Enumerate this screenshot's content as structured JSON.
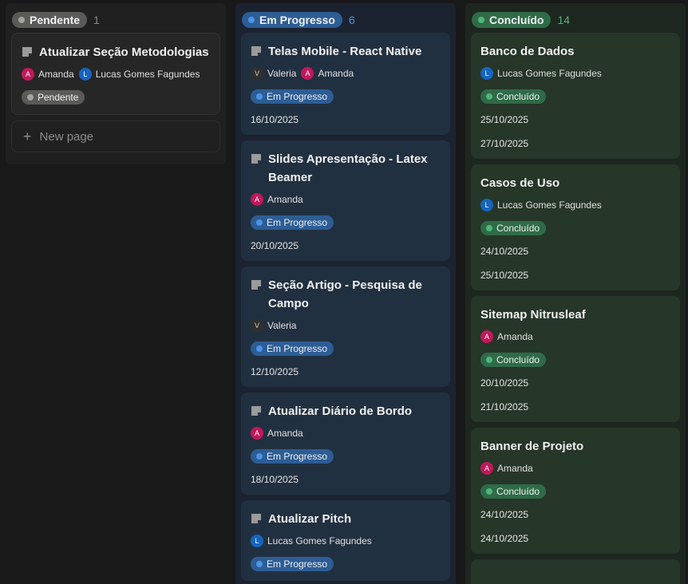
{
  "columns": [
    {
      "status": "Pendente",
      "count": "1",
      "cards": [
        {
          "title": "Atualizar Seção Metodologias",
          "people": [
            "Amanda",
            "Lucas Gomes Fagundes"
          ],
          "tag": "Pendente",
          "dates": []
        }
      ],
      "new_page_label": "New page"
    },
    {
      "status": "Em Progresso",
      "count": "6",
      "cards": [
        {
          "title": "Telas Mobile - React Native",
          "people": [
            "Valeria",
            "Amanda"
          ],
          "tag": "Em Progresso",
          "dates": [
            "16/10/2025"
          ]
        },
        {
          "title": "Slides Apresentação - Latex Beamer",
          "people": [
            "Amanda"
          ],
          "tag": "Em Progresso",
          "dates": [
            "20/10/2025"
          ]
        },
        {
          "title": "Seção Artigo - Pesquisa de Campo",
          "people": [
            "Valeria"
          ],
          "tag": "Em Progresso",
          "dates": [
            "12/10/2025"
          ]
        },
        {
          "title": "Atualizar Diário de Bordo",
          "people": [
            "Amanda"
          ],
          "tag": "Em Progresso",
          "dates": [
            "18/10/2025"
          ]
        },
        {
          "title": "Atualizar Pitch",
          "people": [
            "Lucas Gomes Fagundes"
          ],
          "tag": "Em Progresso",
          "dates": []
        }
      ]
    },
    {
      "status": "Concluído",
      "count": "14",
      "cards": [
        {
          "title": "Banco de Dados",
          "people": [
            "Lucas Gomes Fagundes"
          ],
          "tag": "Concluído",
          "dates": [
            "25/10/2025",
            "27/10/2025"
          ]
        },
        {
          "title": "Casos de Uso",
          "people": [
            "Lucas Gomes Fagundes"
          ],
          "tag": "Concluído",
          "dates": [
            "24/10/2025",
            "25/10/2025"
          ]
        },
        {
          "title": "Sitemap Nitrusleaf",
          "people": [
            "Amanda"
          ],
          "tag": "Concluído",
          "dates": [
            "20/10/2025",
            "21/10/2025"
          ]
        },
        {
          "title": "Banner de Projeto",
          "people": [
            "Amanda"
          ],
          "tag": "Concluído",
          "dates": [
            "24/10/2025",
            "24/10/2025"
          ]
        }
      ]
    }
  ],
  "avatars": {
    "Amanda": "A",
    "Lucas Gomes Fagundes": "L",
    "Valeria": "V"
  },
  "colors": {
    "pending": "#5a5a58",
    "progress": "#2d5d95",
    "done": "#2f6b48",
    "progress_text": "#4a95e6",
    "done_text": "#4fb57a"
  }
}
